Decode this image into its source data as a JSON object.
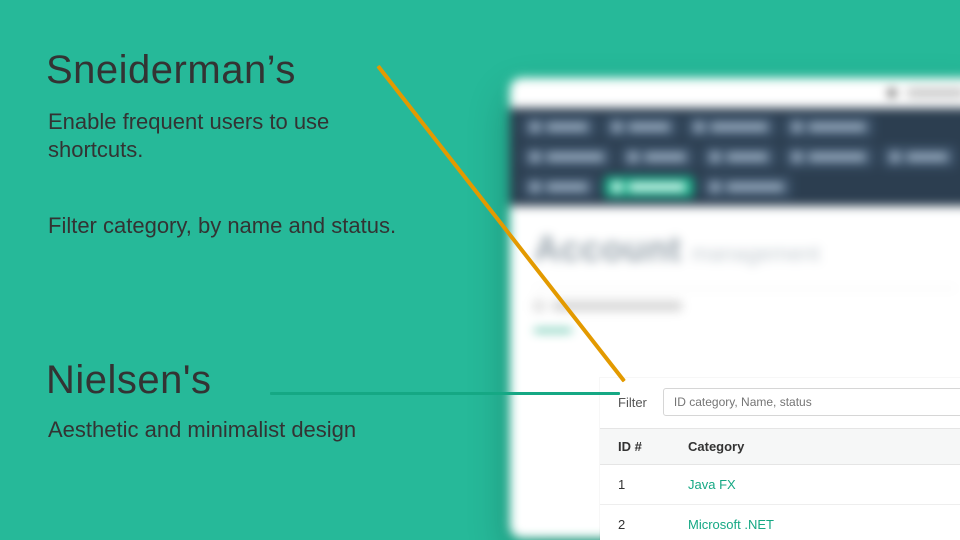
{
  "slide": {
    "heading1": "Sneiderman’s",
    "sub1": "Enable frequent users to use shortcuts.",
    "sub2": "Filter category, by name and status.",
    "heading2": "Nielsen's",
    "sub3": "Aesthetic and minimalist design"
  },
  "app": {
    "title_strong": "Account",
    "title_light": "management",
    "filter_label": "Filter",
    "filter_placeholder": "ID category, Name, status",
    "table": {
      "headers": [
        "ID #",
        "Category"
      ],
      "rows": [
        {
          "id": "1",
          "category": "Java FX"
        },
        {
          "id": "2",
          "category": "Microsoft .NET"
        }
      ]
    }
  },
  "colors": {
    "bg": "#26b999",
    "accent_orange": "#e39a00",
    "accent_green": "#15a884",
    "nav_dark": "#2c3e50"
  }
}
